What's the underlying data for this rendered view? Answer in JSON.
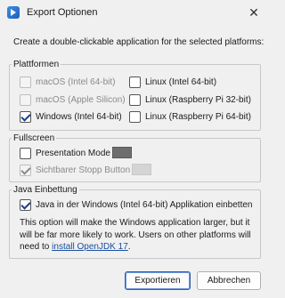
{
  "window": {
    "title": "Export Optionen",
    "close_glyph": "✕"
  },
  "description": "Create a double-clickable application for the selected platforms:",
  "platforms": {
    "legend": "Plattformen",
    "macos_intel": "macOS (Intel 64-bit)",
    "macos_apple": "macOS (Apple Silicon)",
    "windows": "Windows (Intel 64-bit)",
    "linux_intel": "Linux (Intel 64-bit)",
    "linux_rpi32": "Linux (Raspberry Pi 32-bit)",
    "linux_rpi64": "Linux (Raspberry Pi 64-bit)"
  },
  "fullscreen": {
    "legend": "Fullscreen",
    "presentation_mode": "Presentation Mode",
    "stop_button": "Sichtbarer Stopp Button",
    "presentation_color": "#6e6e6e",
    "stop_color": "#d4d4d4"
  },
  "java": {
    "legend": "Java Einbettung",
    "embed_label": "Java in der Windows (Intel 64-bit) Applikation einbetten",
    "info_text": "This option will make the Windows application larger, but it will be far more likely to work. Users on other platforms will need to",
    "link_text": "install OpenJDK 17",
    "period": "."
  },
  "buttons": {
    "export": "Exportieren",
    "cancel": "Abbrechen"
  },
  "colors": {
    "accent": "#2f5fb3",
    "link": "#1a4fa0",
    "background": "#f0f0f0"
  }
}
